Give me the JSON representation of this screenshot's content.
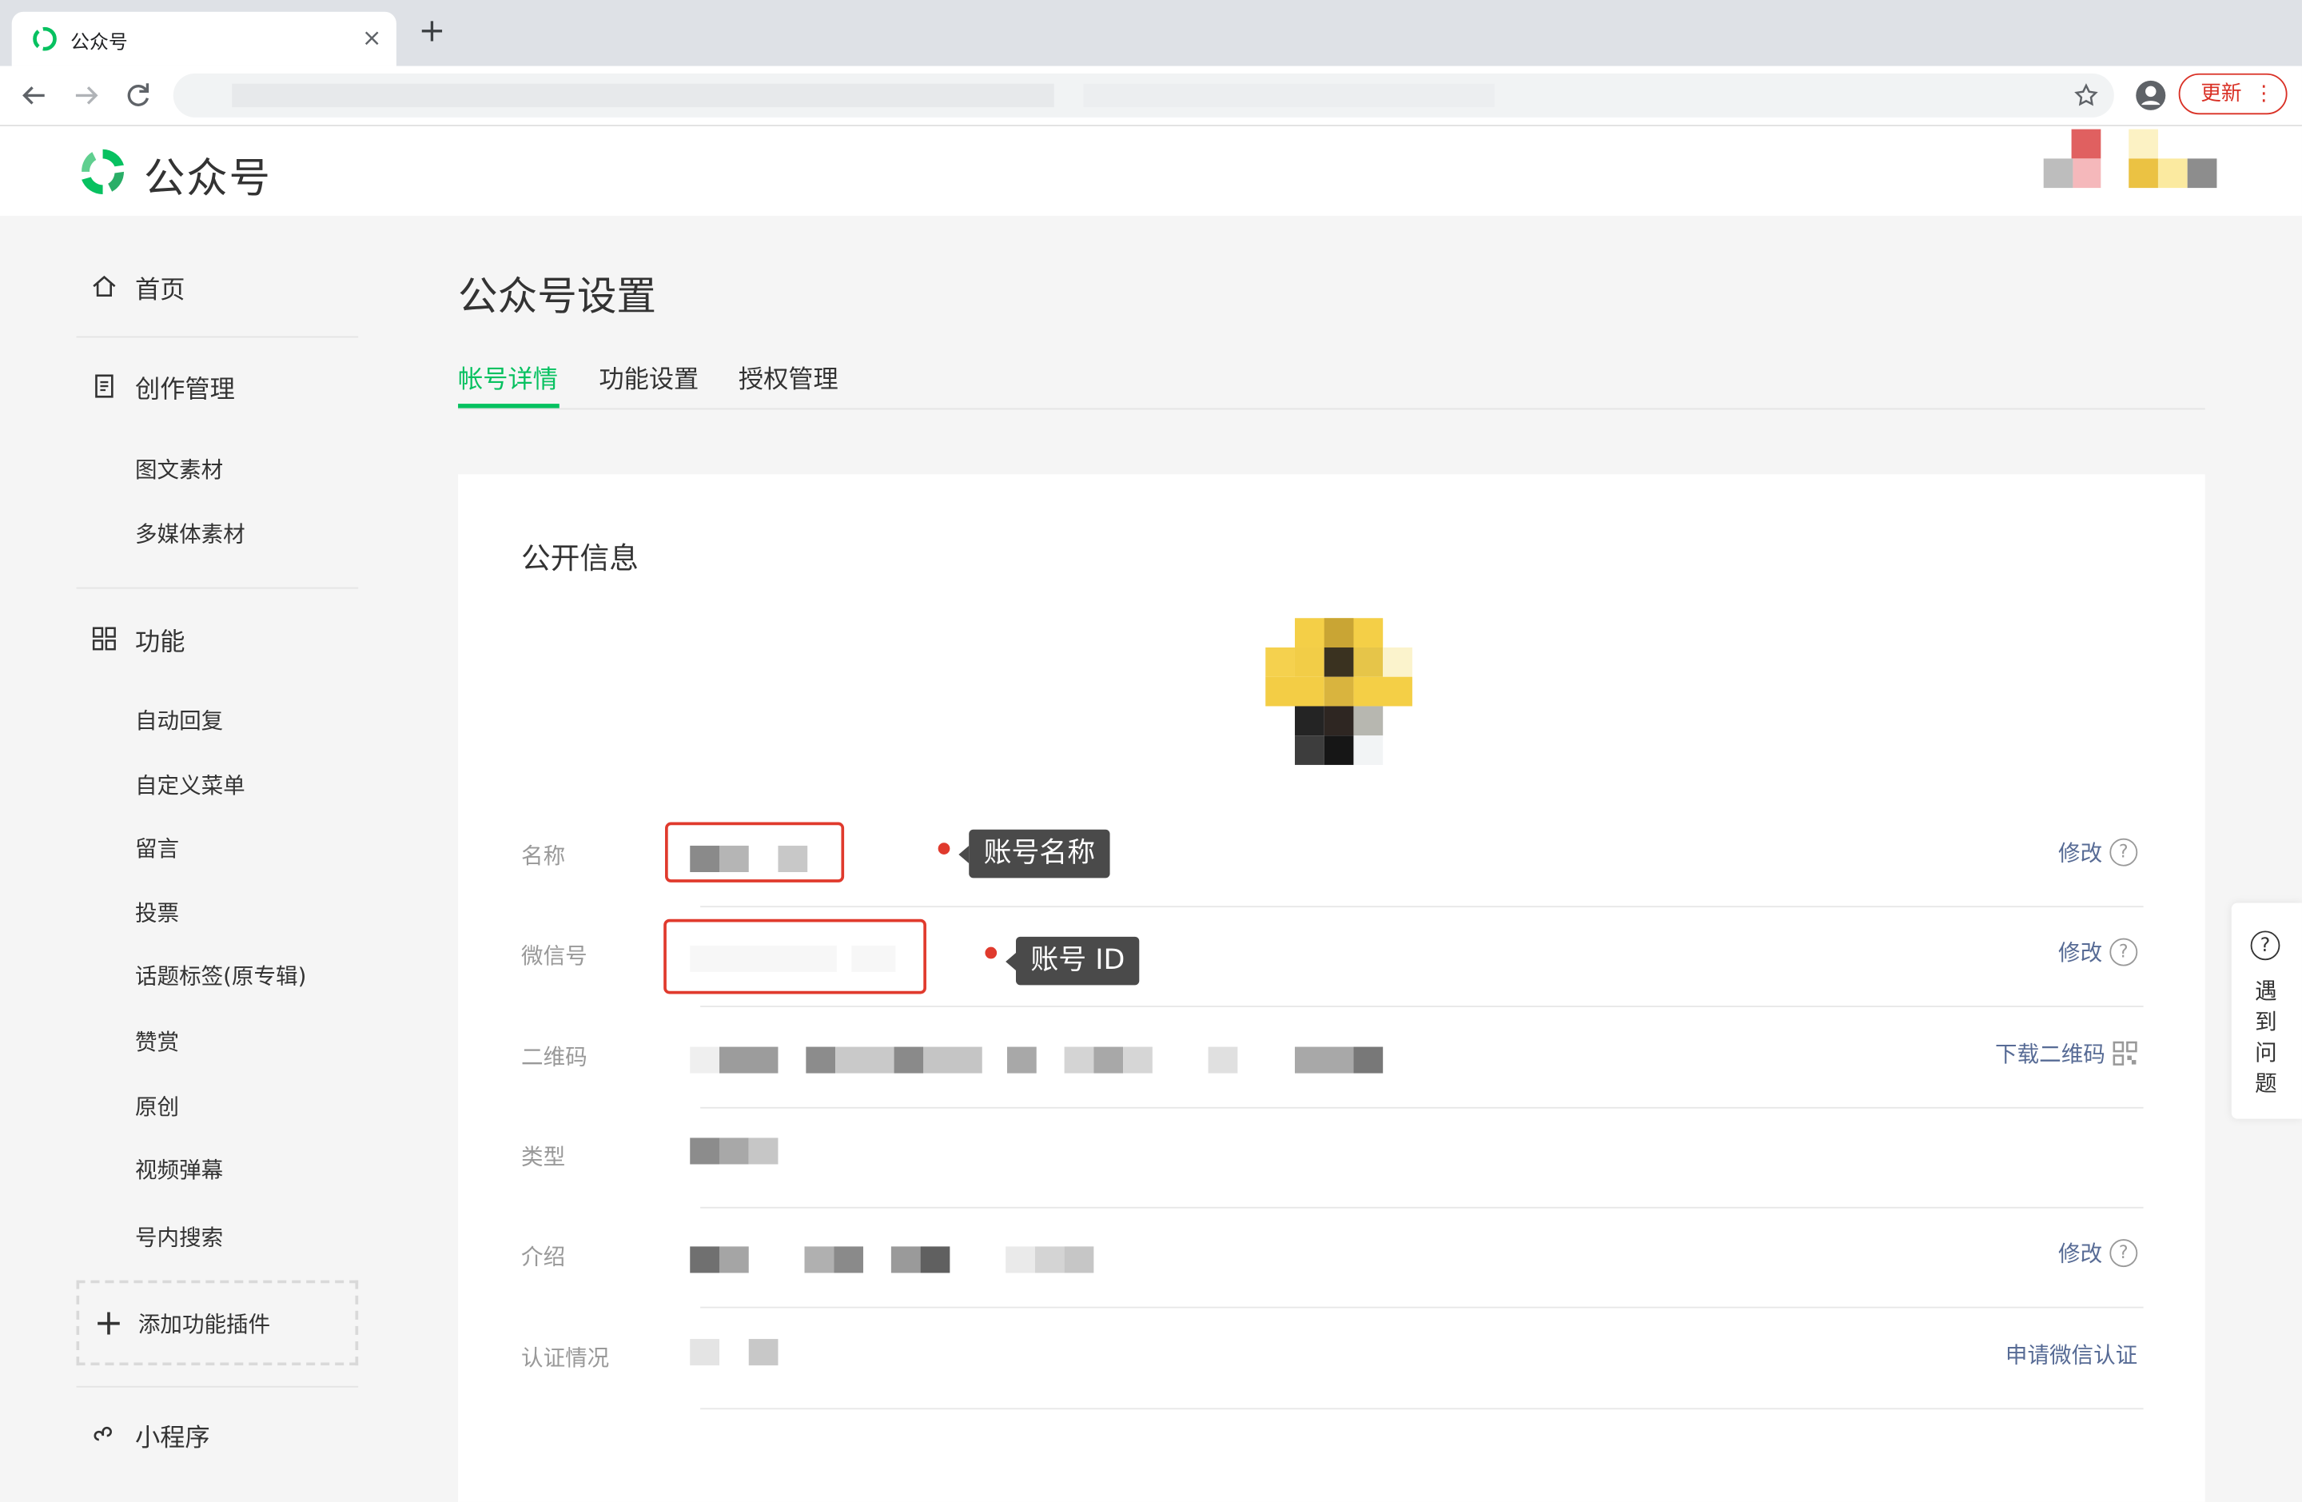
{
  "browser": {
    "tab_title": "公众号",
    "tab_close": "×",
    "new_tab": "+",
    "update_label": "更新",
    "update_menu": "⋮"
  },
  "header": {
    "brand": "公众号"
  },
  "sidebar": {
    "home": "首页",
    "creation": "创作管理",
    "creation_items": [
      "图文素材",
      "多媒体素材"
    ],
    "features": "功能",
    "feature_items": [
      "自动回复",
      "自定义菜单",
      "留言",
      "投票",
      "话题标签(原专辑)",
      "赞赏",
      "原创",
      "视频弹幕",
      "号内搜索"
    ],
    "add_plugin": "添加功能插件",
    "mini_program": "小程序"
  },
  "page": {
    "title": "公众号设置",
    "tabs": [
      {
        "label": "帐号详情",
        "active": true
      },
      {
        "label": "功能设置",
        "active": false
      },
      {
        "label": "授权管理",
        "active": false
      }
    ]
  },
  "public_info": {
    "title": "公开信息",
    "rows": {
      "name": {
        "label": "名称",
        "action": "修改"
      },
      "wechat_id": {
        "label": "微信号",
        "action": "修改"
      },
      "qrcode": {
        "label": "二维码",
        "action": "下载二维码"
      },
      "type": {
        "label": "类型"
      },
      "intro": {
        "label": "介绍",
        "action": "修改"
      },
      "verify": {
        "label": "认证情况",
        "action": "申请微信认证"
      }
    },
    "annotations": {
      "name_tooltip": "账号名称",
      "id_tooltip": "账号 ID"
    }
  },
  "float_help": {
    "icon": "?",
    "label": "遇到问题"
  },
  "colors": {
    "accent": "#07c160",
    "link": "#576b95",
    "annotation": "#e03a2d"
  }
}
